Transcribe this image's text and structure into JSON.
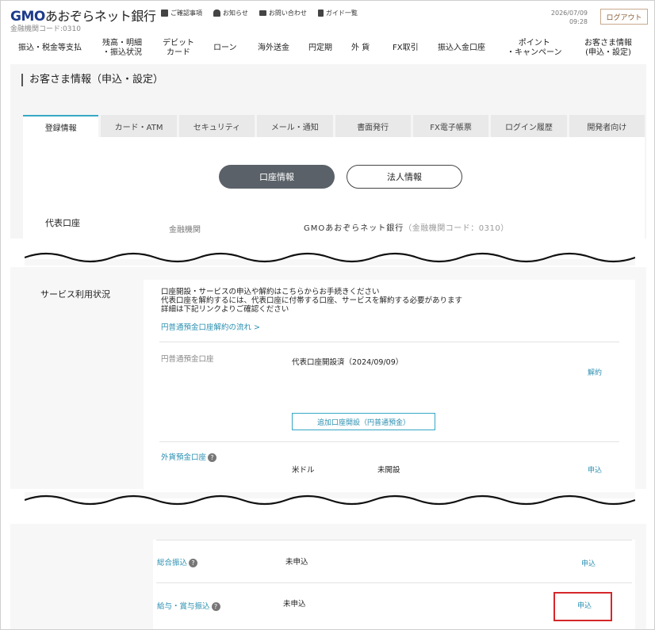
{
  "header": {
    "logo_gmo": "GMO",
    "logo_bank": "あおぞらネット銀行",
    "institution_code": "金融機関コード:0310",
    "top_links": [
      {
        "label": "ご確認事項",
        "icon": "checklist-icon"
      },
      {
        "label": "お知らせ",
        "icon": "bell-icon"
      },
      {
        "label": "お問い合わせ",
        "icon": "mail-icon"
      },
      {
        "label": "ガイド一覧",
        "icon": "guide-book-icon"
      }
    ],
    "date": "2026/07/09",
    "time": "09:28",
    "logout_label": "ログアウト"
  },
  "main_nav": [
    {
      "line1": "振込・税金等支払",
      "line2": ""
    },
    {
      "line1": "残高・明細",
      "line2": "・振込状況"
    },
    {
      "line1": "デビット",
      "line2": "カード"
    },
    {
      "line1": "ローン",
      "line2": ""
    },
    {
      "line1": "海外送金",
      "line2": ""
    },
    {
      "line1": "円定期",
      "line2": ""
    },
    {
      "line1": "外 貨",
      "line2": ""
    },
    {
      "line1": "FX取引",
      "line2": ""
    },
    {
      "line1": "振込入金口座",
      "line2": ""
    },
    {
      "line1": "ポイント",
      "line2": "・キャンペーン"
    },
    {
      "line1": "お客さま情報",
      "line2": "(申込・設定)"
    }
  ],
  "page_title": "お客さま情報（申込・設定）",
  "tabs": [
    "登録情報",
    "カード・ATM",
    "セキュリティ",
    "メール・通知",
    "書面発行",
    "FX電子帳票",
    "ログイン履歴",
    "開発者向け"
  ],
  "pills": {
    "account_info": "口座情報",
    "corporate_info": "法人情報"
  },
  "representative": {
    "label": "代表口座",
    "sub_label": "金融機関",
    "value": "GMOあおぞらネット銀行",
    "code": "（金融機関コード：0310）"
  },
  "services": {
    "label": "サービス利用状況",
    "notes": [
      "口座開設・サービスの申込や解約はこちらからお手続きください",
      "代表口座を解約するには、代表口座に付帯する口座、サービスを解約する必要があります",
      "詳細は下記リンクよりご確認ください"
    ],
    "flow_link": "円普通預金口座解約の流れ >",
    "yen_account": {
      "label": "円普通預金口座",
      "value": "代表口座開設済（2024/09/09）",
      "action": "解約",
      "add_button": "追加口座開設（円普通預金）"
    },
    "fx_account": {
      "label": "外貨預金口座",
      "currency": "米ドル",
      "status": "未開設",
      "action": "申込"
    },
    "general_transfer": {
      "label": "総合振込",
      "status": "未申込",
      "action": "申込"
    },
    "salary_transfer": {
      "label": "給与・賞与振込",
      "status": "未申込",
      "action": "申込"
    }
  },
  "colors": {
    "accent": "#2a8fb0",
    "brand": "#1d3b8c",
    "highlight": "#d6262a"
  }
}
